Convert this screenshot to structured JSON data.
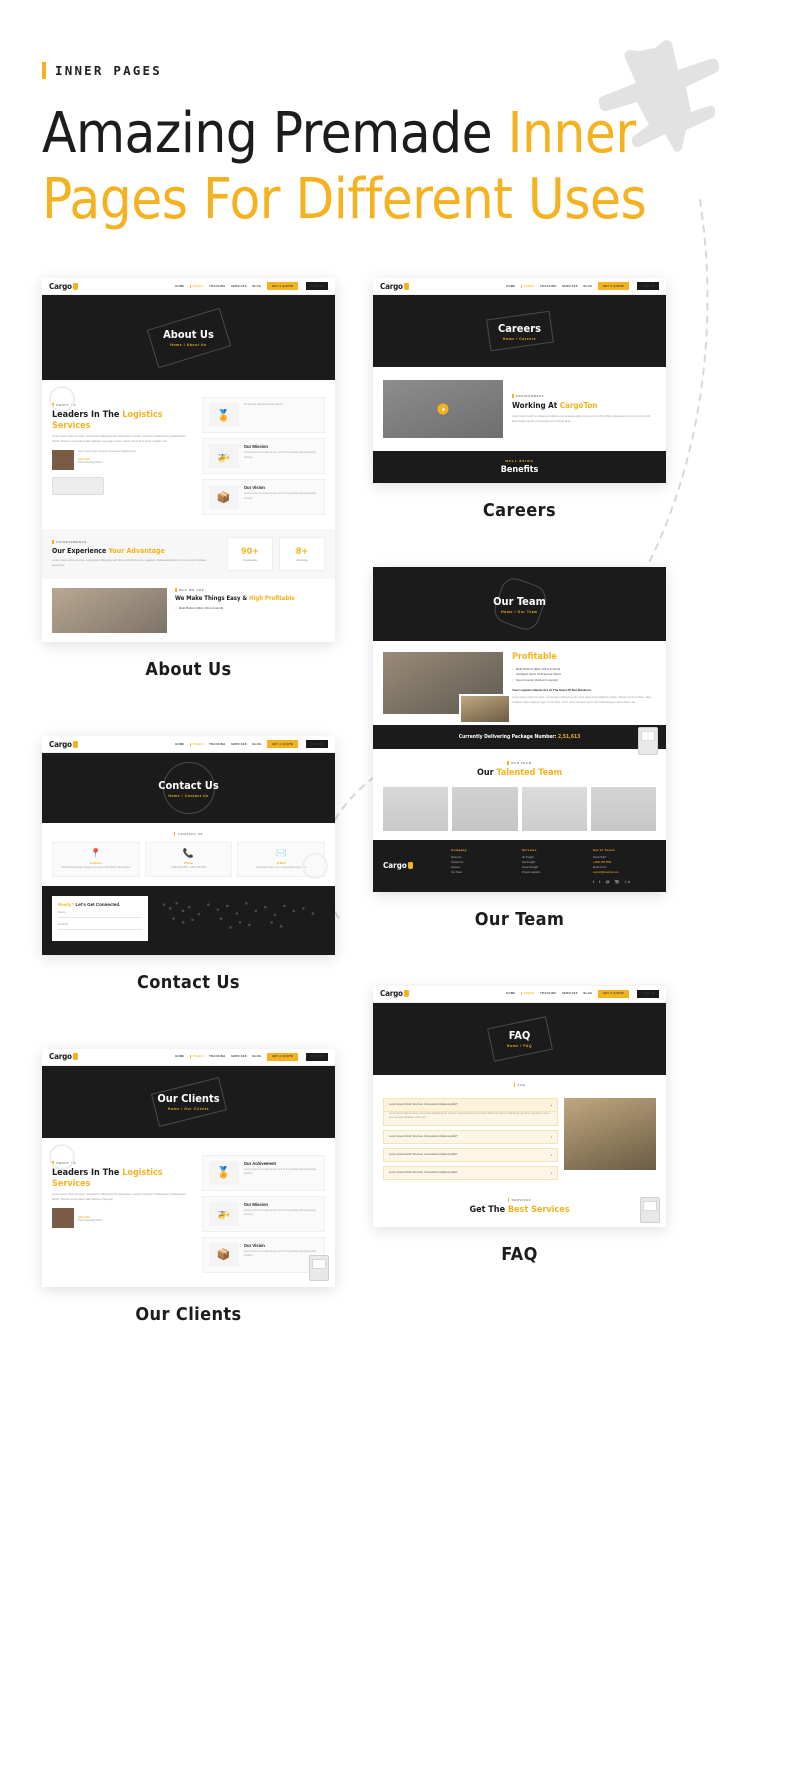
{
  "header": {
    "eyebrow": "INNER PAGES",
    "headline_line1_dark": "Amazing Premade ",
    "headline_line1_accent": "Inner",
    "headline_line2": "Pages For Different Uses"
  },
  "colors": {
    "accent": "#F5B220",
    "dark": "#1b1b1b",
    "text": "#1c1c1c",
    "muted": "#9a9a9a",
    "page_bg": "#ffffff"
  },
  "nav": {
    "logo": "Cargo",
    "items": [
      "HOME",
      "PAGES",
      "TRACKING",
      "SERVICES",
      "BLOG"
    ],
    "active_item": "PAGES",
    "cta_primary": "GET A QUOTE",
    "cta_secondary": "SIGN IN"
  },
  "mockups": [
    {
      "caption": "About Us",
      "hero_title": "About Us",
      "breadcrumb": "Home / About Us",
      "section_label": "ABOUT US",
      "heading_dark": "Leaders In The ",
      "heading_accent": "Logistics Services",
      "paragraph": "Lorem ipsum dolor sit amet, consectetur adipiscing elit. Elementum semper hendrerit condimentum pellentesque facilisi. Pretium amet tellus nulla natoque urna eget. Lacus massa nisl sit id et purus sodales nisl.",
      "quote": "Lorem ipsum dolor sit amet, consectetur adipiscing elit.",
      "author_name": "John Rai",
      "author_role": "Chief Operating Officer",
      "cards": [
        {
          "title": "",
          "text": "the printing and typesetting industry"
        },
        {
          "title": "Our Mission",
          "text": "Lorem Ipsum is simply dummy text of the printing and typesetting industry."
        },
        {
          "title": "Our Vision",
          "text": "Lorem Ipsum is simply dummy text of the printing and typesetting industry."
        }
      ],
      "stats_label": "ACHIEVEMENTS",
      "stats_heading_dark": "Our Experience ",
      "stats_heading_accent": "Your Advantage",
      "stats_paragraph": "Lorem ipsum dolor sit amet, consectetur adipiscing elit. Nisi, at tincidunt urna, praesent. Malesuada fusce in rhoncus velit tristique accumsan.",
      "stats": [
        {
          "value": "90+",
          "label": "Companies"
        },
        {
          "value": "8+",
          "label": "Countries"
        }
      ],
      "bottom_label": "WHY WE ARE",
      "bottom_heading_dark": "We Make Things Easy & ",
      "bottom_heading_accent": "High Profitable",
      "bottom_bullet": "Multi Platform (Web, iOS & Android)"
    },
    {
      "caption": "Careers",
      "hero_title": "Careers",
      "breadcrumb": "Home / Careers",
      "section_label": "ENVIRONMENT",
      "heading_dark": "Working At ",
      "heading_accent": "CargoTon",
      "paragraph": "Amet minim mollit non deserunt ullamco est sit aliqua dolor do amet sint. Velit officia consequat duis enim velit mollit. Exercitation veniam consequat sunt nostrud amet.",
      "band_label": "WELL BEING",
      "band_title": "Benefits"
    },
    {
      "caption": "Contact Us",
      "hero_title": "Contact Us",
      "breadcrumb": "Home / Contact Us",
      "section_label": "CONTACT US",
      "contact_cards": [
        {
          "icon": "location-icon",
          "title": "Address",
          "text": "4578 Marmora Road, Glasgow, Dominion, D04 89GR, United States"
        },
        {
          "icon": "phone-icon",
          "title": "Phone",
          "text": "+1800 456 5555 / +1800 456 6666"
        },
        {
          "icon": "mail-icon",
          "title": "E-Mail",
          "text": "support@example.com / mail.help@example.com"
        }
      ],
      "form_heading_accent": "Ready?",
      "form_heading_dark": " Let's Get Connected.",
      "form_fields": [
        {
          "label": "Name :",
          "value": ""
        },
        {
          "label": "Email ID :",
          "value": ""
        }
      ]
    },
    {
      "caption": "Our Team",
      "hero_title": "Our Team",
      "breadcrumb": "Home / Our Team",
      "heading_accent": "Profitable",
      "bullets": [
        "Multi Platform (Web, iOS & Android)",
        "Intelligent Alerts Of Shipment Status",
        "Green Counter (Carbon Footprint)"
      ],
      "subheading": "Your Logistics Needs Are At The Heart Of Our Business",
      "subparagraph": "Lorem ipsum dolor sit amet, consectetur adipiscing elit. Amet ligula risus adipiscing dolor. Aliquet turpis sit vitae, atqui, tincidunt. Diam aliquam eget. Purus duis. Amet. Amet rhoncus turpis nisl. Pellentesque mauris lacus dui.",
      "ticker_label": "Currently Delivering Package Number: ",
      "ticker_value": "2,51,613",
      "team_label": "OUR TEAM",
      "team_heading_dark": "Our ",
      "team_heading_accent": "Talented Team",
      "members": [
        "member-1",
        "member-2",
        "member-3",
        "member-4"
      ],
      "footer": {
        "logo": "Cargo",
        "columns": [
          {
            "title": "Company",
            "items": [
              "About Us",
              "Contact Us",
              "Careers",
              "Our Team"
            ]
          },
          {
            "title": "Services",
            "items": [
              "Air Freight",
              "Sea Freight",
              "Ocean Freight",
              "Project Logistics"
            ]
          },
          {
            "title": "Get In Touch",
            "items": [
              "Need Help?",
              "+1800 456 5555",
              "Email Us At:",
              "support@example.com"
            ]
          }
        ]
      }
    },
    {
      "caption": "Our Clients",
      "hero_title": "Our Clients",
      "breadcrumb": "Home / Our Clients",
      "section_label": "ABOUT US",
      "heading_dark": "Leaders In The ",
      "heading_accent": "Logistics Services",
      "paragraph": "Lorem ipsum dolor sit amet, consectetur adipiscing elit. Elementum semper hendrerit condimentum pellentesque facilisi. Pretium amet tellus nulla natoque urna eget.",
      "author_name": "John Rai",
      "author_role": "Chief Operating Officer",
      "cards": [
        {
          "title": "Our Achivement",
          "text": "Lorem Ipsum is simply dummy text of the printing and typesetting industry."
        },
        {
          "title": "Our Mission",
          "text": "Lorem Ipsum is simply dummy text of the printing and typesetting industry."
        },
        {
          "title": "Our Vision",
          "text": "Lorem Ipsum is simply dummy text of the printing and typesetting industry."
        }
      ]
    },
    {
      "caption": "FAQ",
      "hero_title": "FAQ",
      "breadcrumb": "Home / FAQ",
      "section_label": "FAQ",
      "faq_items": [
        {
          "q": "Lorem Ipsum Dolor Sit Amet, Consectetur Adipiscing Elit?",
          "open": true,
          "a": "Lorem ipsum dolor sit amet, consectetur adipiscing elit. At amet mauris parturient amet risus. Mattis bibendum in adipiscing eget libero egestas in donec. Amet aenean habitasse mollis sem."
        },
        {
          "q": "Lorem Ipsum Dolor Sit Amet, Consectetur Adipiscing Elit?",
          "open": false,
          "a": ""
        },
        {
          "q": "Lorem Ipsum Dolor Sit Amet, Consectetur Adipiscing Elit?",
          "open": false,
          "a": ""
        },
        {
          "q": "Lorem Ipsum Dolor Sit Amet, Consectetur Adipiscing Elit?",
          "open": false,
          "a": ""
        }
      ],
      "bottom_label": "SERVICES",
      "bottom_heading_dark": "Get The ",
      "bottom_heading_accent": "Best Services"
    }
  ]
}
